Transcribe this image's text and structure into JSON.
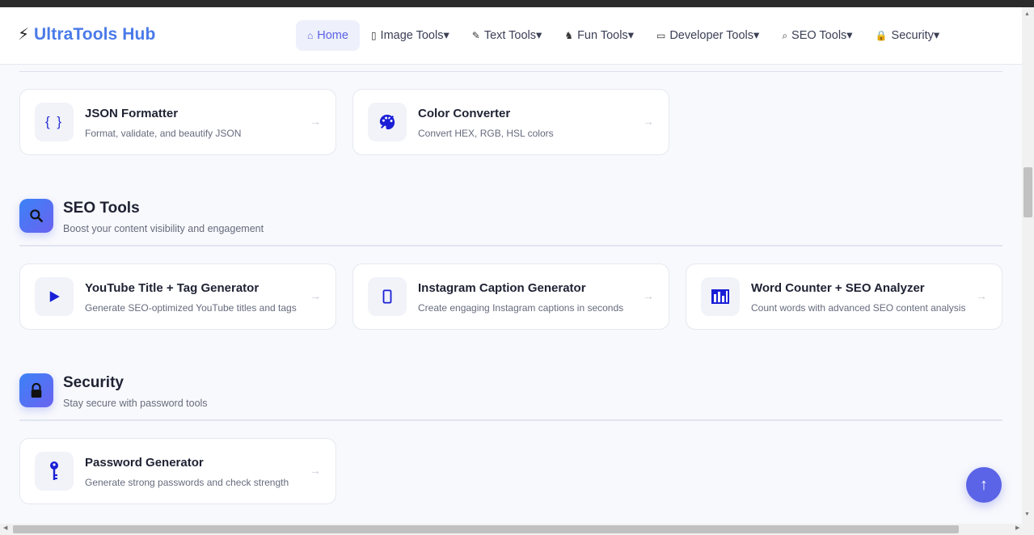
{
  "app": {
    "brand_icon": "⚡",
    "title": "UltraTools Hub"
  },
  "nav": [
    {
      "icon": "⌂",
      "icon_name": "home-icon",
      "label": "Home",
      "caret": ""
    },
    {
      "icon": "▯",
      "icon_name": "image-icon",
      "label": "Image Tools",
      "caret": "▾"
    },
    {
      "icon": "✎",
      "icon_name": "text-icon",
      "label": "Text Tools",
      "caret": "▾"
    },
    {
      "icon": "♞",
      "icon_name": "gamepad-icon",
      "label": "Fun Tools",
      "caret": "▾"
    },
    {
      "icon": "▭",
      "icon_name": "laptop-icon",
      "label": "Developer Tools",
      "caret": "▾"
    },
    {
      "icon": "⌕",
      "icon_name": "search-icon",
      "label": "SEO Tools",
      "caret": "▾"
    },
    {
      "icon": "🔒",
      "icon_name": "lock-icon",
      "label": "Security",
      "caret": "▾"
    }
  ],
  "developer_cards": [
    {
      "icon": "{ }",
      "icon_name": "braces-icon",
      "title": "JSON Formatter",
      "desc": "Format, validate, and beautify JSON",
      "arrow": "→"
    },
    {
      "icon": "palette",
      "icon_name": "palette-icon",
      "title": "Color Converter",
      "desc": "Convert HEX, RGB, HSL colors",
      "arrow": "→"
    }
  ],
  "seo_section": {
    "title": "SEO Tools",
    "subtitle": "Boost your content visibility and engagement",
    "icon_name": "search-icon"
  },
  "seo_cards": [
    {
      "icon_name": "play-icon",
      "title": "YouTube Title + Tag Generator",
      "desc": "Generate SEO-optimized YouTube titles and tags",
      "arrow": "→"
    },
    {
      "icon_name": "phone-icon",
      "title": "Instagram Caption Generator",
      "desc": "Create engaging Instagram captions in seconds",
      "arrow": "→"
    },
    {
      "icon_name": "bar-chart-icon",
      "title": "Word Counter + SEO Analyzer",
      "desc": "Count words with advanced SEO content analysis",
      "arrow": "→"
    }
  ],
  "security_section": {
    "title": "Security",
    "subtitle": "Stay secure with password tools",
    "icon_name": "lock-icon"
  },
  "security_cards": [
    {
      "icon_name": "key-icon",
      "title": "Password Generator",
      "desc": "Generate strong passwords and check strength",
      "arrow": "→"
    }
  ],
  "back_to_top": {
    "label": "↑"
  },
  "colors": {
    "accent": "#5b63e6",
    "brand": "#4a7ae8",
    "section_gradient_start": "#3b82f6",
    "section_gradient_end": "#6a63f0",
    "icon_blue": "#1a1fd6"
  }
}
